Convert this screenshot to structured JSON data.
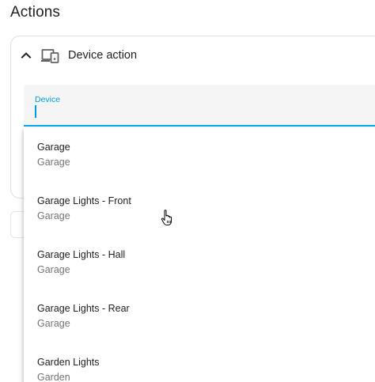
{
  "section": {
    "title": "Actions"
  },
  "card": {
    "title": "Device action",
    "collapse_icon": "chevron-up-icon",
    "type_icon": "devices-icon"
  },
  "device_field": {
    "label": "Device",
    "value": ""
  },
  "options": [
    {
      "name": "Garage",
      "area": "Garage"
    },
    {
      "name": "Garage Lights - Front",
      "area": "Garage"
    },
    {
      "name": "Garage Lights - Hall",
      "area": "Garage"
    },
    {
      "name": "Garage Lights - Rear",
      "area": "Garage"
    },
    {
      "name": "Garden Lights",
      "area": "Garden"
    }
  ],
  "colors": {
    "accent": "#03a9f4",
    "field_bg": "#f5f5f5",
    "secondary_text": "#757575"
  },
  "pointer": "hand-pointer-icon"
}
